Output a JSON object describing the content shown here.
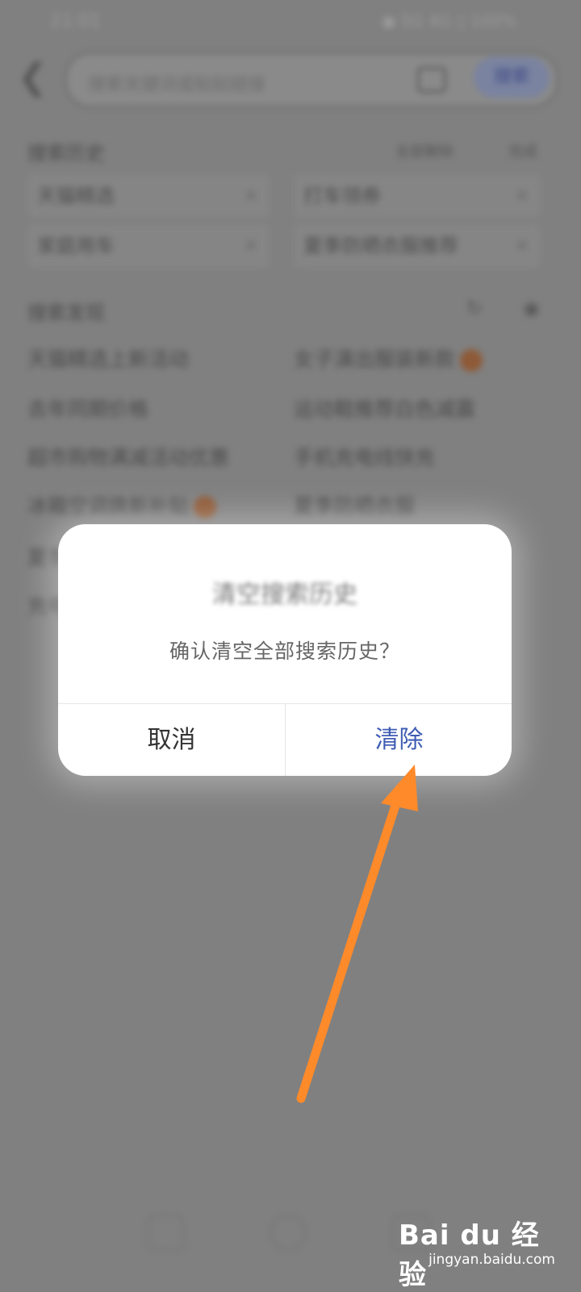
{
  "status_bar": {
    "time": "21:01",
    "right": "◼ 5G 4G ▯ 100%"
  },
  "search": {
    "back_icon": "chevron-left-icon",
    "placeholder": "搜索关键词或粘贴链接",
    "camera_icon": "camera-icon",
    "button_label": "搜索"
  },
  "history": {
    "title": "搜索历史",
    "clear_all_label": "全部删除",
    "done_label": "完成",
    "chips": [
      "天猫精选",
      "打车领券",
      "家庭用车",
      "夏季防晒衣服推荐"
    ]
  },
  "discover": {
    "title": "搜索发现",
    "refresh_icon": "refresh-icon",
    "hide_icon": "eye-icon",
    "left_items": [
      "天猫精选上新活动",
      "去年同期价格",
      "超市购物满减活动优惠",
      "冰箱空调换新补贴",
      "夏季",
      "充电"
    ],
    "right_items": [
      "女子演出服装新款",
      "运动鞋推荐白色减震",
      "手机充电线快充",
      "夏季防晒衣服"
    ],
    "hot_badge_color": "#e07a35"
  },
  "dialog": {
    "title": "清空搜索历史",
    "message": "确认清空全部搜索历史？",
    "cancel_label": "取消",
    "confirm_label": "清除",
    "confirm_color": "#3f5db4"
  },
  "annotation": {
    "arrow_color": "#ff8a2a"
  },
  "watermark": {
    "brand": "Bai du 经验",
    "url": "jingyan.baidu.com"
  }
}
